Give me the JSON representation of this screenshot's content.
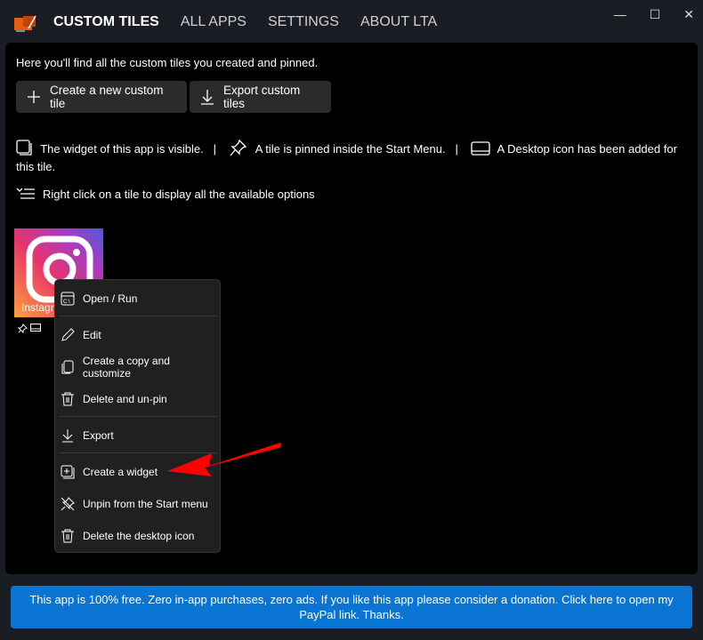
{
  "nav": {
    "tabs": [
      "CUSTOM TILES",
      "ALL APPS",
      "SETTINGS",
      "ABOUT LTA"
    ],
    "active": "CUSTOM TILES"
  },
  "window": {
    "minimize": "—",
    "maximize": "☐",
    "close": "✕"
  },
  "main": {
    "intro": "Here you'll find all the custom tiles you created and pinned.",
    "create_button": "Create a new custom tile",
    "export_button": "Export custom tiles",
    "legend_widget": "The widget of this app is visible.",
    "sep": "|",
    "legend_pin": "A tile is pinned inside the Start Menu.",
    "legend_desktop": "A Desktop icon has been added for this tile.",
    "hint": "Right click on a tile to display all the available options"
  },
  "tile": {
    "label": "Instagram",
    "icon": "instagram-icon"
  },
  "menu": {
    "items": [
      "Open / Run",
      "Edit",
      "Create a copy and customize",
      "Delete and un-pin",
      "Export",
      "Create a widget",
      "Unpin from the Start menu",
      "Delete the desktop icon"
    ]
  },
  "banner": {
    "text": "This app is 100% free. Zero in-app purchases, zero ads. If you like this app please consider a donation. Click here to open my PayPal link. Thanks."
  },
  "colors": {
    "banner": "#0a74d2",
    "arrow": "#ff0000",
    "menu_bg": "#202020"
  }
}
